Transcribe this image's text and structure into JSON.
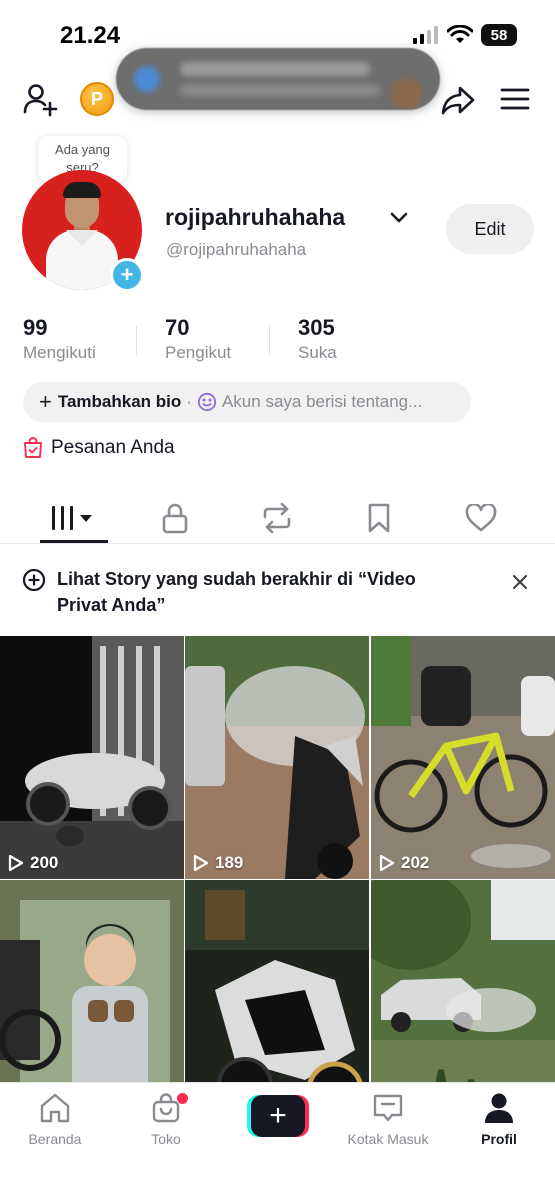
{
  "status_bar": {
    "time": "21.24",
    "battery": "58"
  },
  "tooltip": {
    "line1": "Ada yang",
    "line2": "seru?"
  },
  "profile": {
    "username": "rojipahruhahaha",
    "handle": "@rojipahruhahaha",
    "edit_label": "Edit"
  },
  "stats": [
    {
      "value": "99",
      "label": "Mengikuti"
    },
    {
      "value": "70",
      "label": "Pengikut"
    },
    {
      "value": "305",
      "label": "Suka"
    }
  ],
  "bio": {
    "add_label": "Tambahkan bio",
    "separator": "·",
    "placeholder": "Akun saya berisi tentang..."
  },
  "orders": {
    "label": "Pesanan Anda"
  },
  "tabs": [
    "videos",
    "private",
    "reposts",
    "favorites",
    "liked"
  ],
  "story_banner": {
    "text": "Lihat Story yang sudah berakhir di “Video Privat Anda”"
  },
  "videos": [
    {
      "views": "200"
    },
    {
      "views": "189"
    },
    {
      "views": "202"
    },
    {
      "views": ""
    },
    {
      "views": ""
    },
    {
      "views": ""
    }
  ],
  "bottom_nav": {
    "home": "Beranda",
    "shop": "Toko",
    "inbox": "Kotak Masuk",
    "profile": "Profil"
  },
  "colors": {
    "accent_pink": "#fe2c55",
    "accent_cyan": "#25f4ee",
    "avatar_bg": "#d8201f",
    "coin": "#f39c12",
    "add_avatar": "#45b4e6"
  }
}
